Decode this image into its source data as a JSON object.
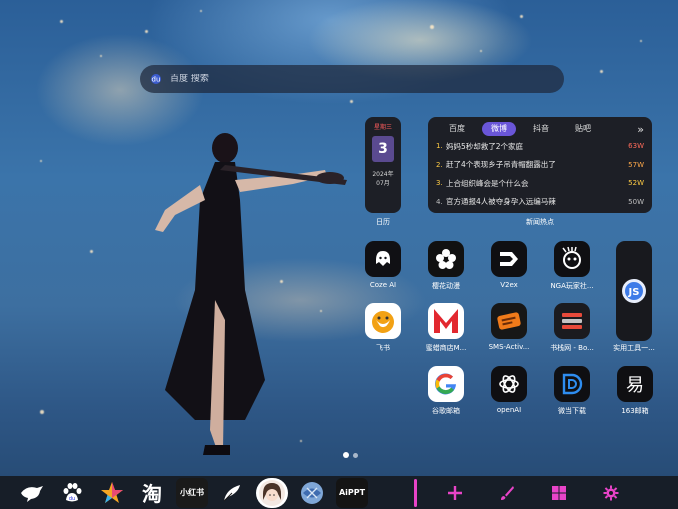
{
  "search": {
    "placeholder": "百度 搜索"
  },
  "calendar": {
    "weekday": "星期三",
    "day": "3",
    "year": "2024年",
    "month": "07月",
    "label": "日历"
  },
  "hot_news": {
    "tabs": [
      "百度",
      "微博",
      "抖音",
      "贴吧"
    ],
    "active_tab": "微博",
    "more": "»",
    "items": [
      {
        "rank": "1.",
        "title": "妈妈5秒却救了2个家庭",
        "heat": "63W",
        "color": "#ff6b5a"
      },
      {
        "rank": "2.",
        "title": "赶了4个表现乡子吊青帽翻露出了",
        "heat": "57W",
        "color": "#ffa94a"
      },
      {
        "rank": "3.",
        "title": "上合组织峰会是个什么会",
        "heat": "52W",
        "color": "#ffcc44"
      },
      {
        "rank": "4.",
        "title": "官方通报4人被夺身孕入远编马辣",
        "heat": "50W",
        "color": "#bfbfbf"
      }
    ],
    "label": "新闻热点"
  },
  "apps": [
    {
      "name": "Coze AI",
      "icon": "coze-icon"
    },
    {
      "name": "樱花动漫",
      "icon": "sakura-icon"
    },
    {
      "name": "V2ex",
      "icon": "v2ex-icon"
    },
    {
      "name": "NGA玩家社...",
      "icon": "nga-icon"
    },
    {
      "name": "飞书",
      "icon": "feishu-icon"
    },
    {
      "name": "蜜蜡商店M...",
      "icon": "mall-icon"
    },
    {
      "name": "SMS-Activ...",
      "icon": "sms-icon"
    },
    {
      "name": "书栈网 - Bo...",
      "icon": "bookstack-icon"
    },
    {
      "name": "谷歌邮箱",
      "icon": "google-icon"
    },
    {
      "name": "openAI",
      "icon": "openai-icon"
    },
    {
      "name": "微当下载",
      "icon": "weidang-icon"
    },
    {
      "name": "163邮箱",
      "icon": "163-mail-icon"
    }
  ],
  "tall_app": {
    "name": "实用工具一...",
    "icon": "toolkit-icon"
  },
  "dock": {
    "apps": [
      "bird-icon",
      "baidu-paw-icon",
      "star-icon",
      "taobao-icon",
      "xiaohongshu-icon",
      "quill-icon",
      "avatar-icon",
      "feather-ball-icon",
      "aippt-icon"
    ],
    "taobao_text": "淘",
    "xhs_text": "小红书",
    "aippt_text": "AiPPT"
  },
  "colors": {
    "accent": "#6a56d8",
    "dock_separator": "#e844c8",
    "system_icons": "#e844c8"
  }
}
